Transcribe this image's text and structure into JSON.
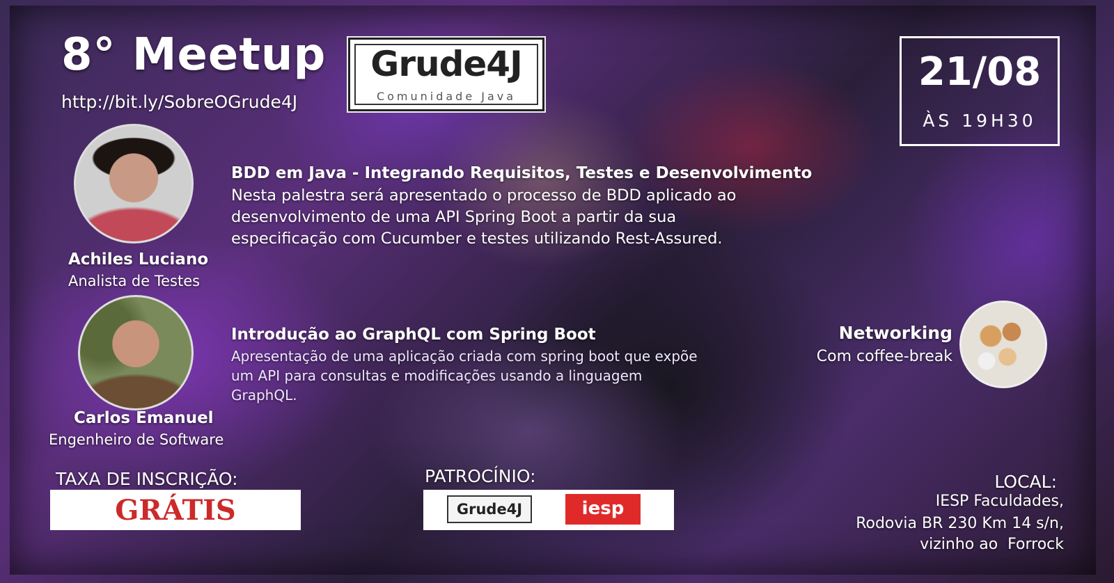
{
  "header": {
    "title": "8° Meetup",
    "url": "http://bit.ly/SobreOGrude4J",
    "logo_name": "Grude4J",
    "logo_sub": "Comunidade Java"
  },
  "event": {
    "date": "21/08",
    "time": "ÀS 19H30"
  },
  "talks": [
    {
      "speaker": "Achiles Luciano",
      "role": "Analista de Testes",
      "title": "BDD em Java - Integrando Requisitos, Testes e Desenvolvimento",
      "desc_lines": [
        "Nesta palestra será apresentado o processo de BDD aplicado ao",
        "desenvolvimento de uma API Spring Boot a partir da sua",
        "especificação com Cucumber e testes utilizando Rest-Assured."
      ]
    },
    {
      "speaker": "Carlos Emanuel",
      "role": "Engenheiro de Software",
      "title": "Introdução ao GraphQL com Spring Boot",
      "desc_lines": [
        "Apresentação de uma aplicação criada com spring boot que expõe",
        "um API para consultas e modificações usando a linguagem",
        "GraphQL."
      ]
    }
  ],
  "networking": {
    "title": "Networking",
    "subtitle": "Com coffee-break"
  },
  "fee": {
    "label": "TAXA DE INSCRIÇÃO:",
    "value": "GRÁTIS"
  },
  "sponsor": {
    "label": "PATROCÍNIO:",
    "logos": [
      "Grude4J",
      "iesp"
    ]
  },
  "location": {
    "label": "LOCAL:",
    "lines": [
      "IESP Faculdades,",
      "Rodovia BR 230 Km 14 s/n,",
      "vizinho ao  Forrock"
    ]
  },
  "colors": {
    "fee_red": "#cc2a2a",
    "iesp_red": "#e02a2a"
  }
}
